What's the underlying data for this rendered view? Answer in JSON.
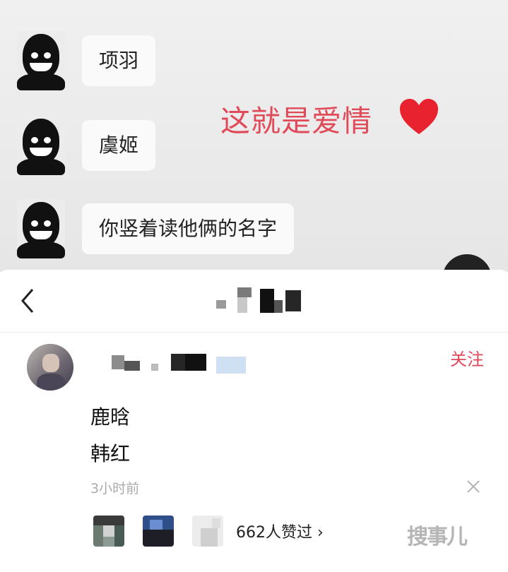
{
  "chat": {
    "messages": [
      {
        "text": "项羽"
      },
      {
        "text": "虞姬"
      },
      {
        "text": "你竖着读他俩的名字"
      }
    ],
    "overlay_text": "这就是爱情"
  },
  "comment": {
    "follow_label": "关注",
    "lines": [
      "鹿晗",
      "韩红"
    ],
    "timestamp": "3小时前",
    "likes_label": "662人赞过 ›"
  },
  "watermark": "搜事儿",
  "colors": {
    "accent_red": "#e0485a",
    "overlay_pink": "#e04a59",
    "heart": "#e8232f"
  },
  "icons": [
    "back-icon",
    "close-icon",
    "heart-icon",
    "avatar-icon"
  ]
}
